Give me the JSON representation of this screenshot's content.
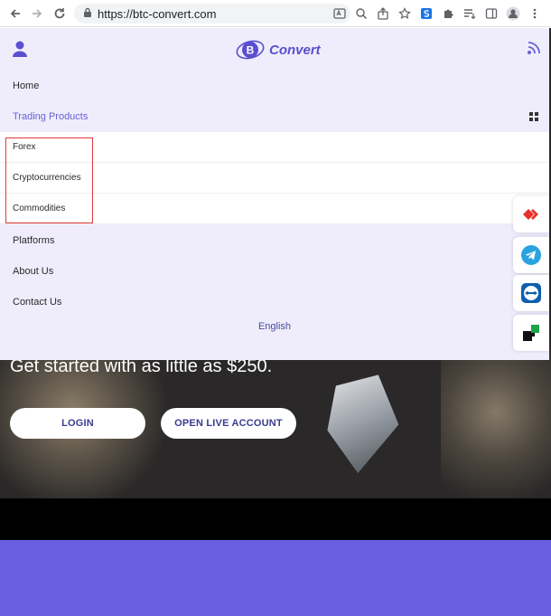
{
  "browser": {
    "url": "https://btc-convert.com"
  },
  "header": {
    "logo_text": "Convert"
  },
  "menu": {
    "items": [
      {
        "label": "Home"
      },
      {
        "label": "Trading Products"
      },
      {
        "label": "Platforms"
      },
      {
        "label": "About Us"
      },
      {
        "label": "Contact Us"
      }
    ],
    "submenu": [
      {
        "label": "Forex"
      },
      {
        "label": "Cryptocurrencies"
      },
      {
        "label": "Commodities"
      }
    ],
    "language": "English"
  },
  "hero": {
    "tagline": "Get started with as little as $250.",
    "login_label": "LOGIN",
    "live_label": "OPEN LIVE ACCOUNT"
  },
  "colors": {
    "accent": "#6a60d6",
    "menu_bg": "#efedfc",
    "purple_band": "#6a5fe0",
    "highlight": "#e03a3a"
  }
}
